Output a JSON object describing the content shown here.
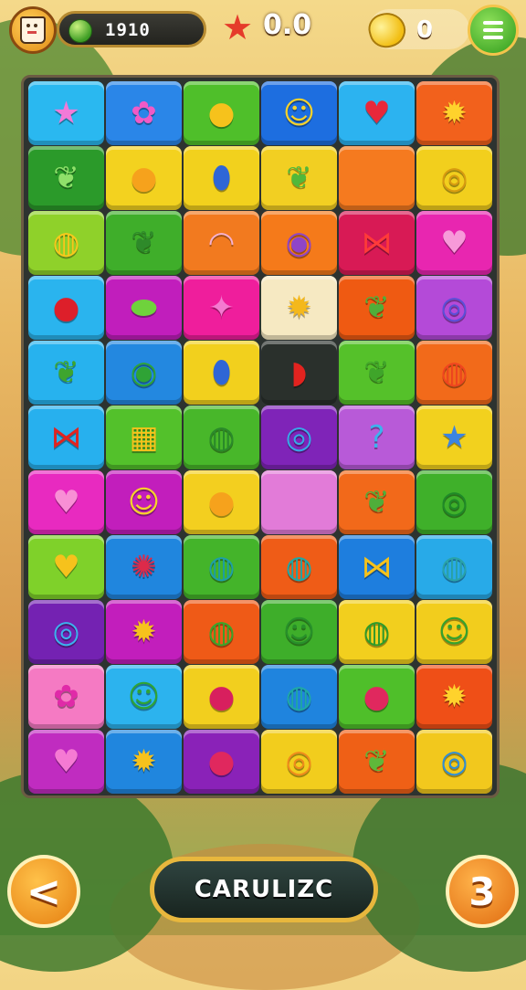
{
  "hud": {
    "coins": "1910",
    "score": "0.0",
    "lemons": "0"
  },
  "board": {
    "rows": [
      [
        {
          "color": "#2ab8f0",
          "icon": "star-icon",
          "glyph": "★",
          "fg": "#f27ad8"
        },
        {
          "color": "#2a86e8",
          "icon": "flower-icon",
          "glyph": "✿",
          "fg": "#f05ac6"
        },
        {
          "color": "#4fbf2a",
          "icon": "apple-icon",
          "glyph": "●",
          "fg": "#f6c21c"
        },
        {
          "color": "#1d6ee0",
          "icon": "sun-face-icon",
          "glyph": "☺",
          "fg": "#f6d22b"
        },
        {
          "color": "#2cb3f0",
          "icon": "heart-icon",
          "glyph": "♥",
          "fg": "#e8283a"
        },
        {
          "color": "#f2611c",
          "icon": "sun-icon",
          "glyph": "✹",
          "fg": "#ffd22c"
        }
      ],
      [
        {
          "color": "#2b9a2a",
          "icon": "leaf-icon",
          "glyph": "❦",
          "fg": "#8fe06a"
        },
        {
          "color": "#f3d21f",
          "icon": "apple-icon",
          "glyph": "●",
          "fg": "#f6a21c"
        },
        {
          "color": "#f2d11d",
          "icon": "egg-icon",
          "glyph": "⬮",
          "fg": "#2f66d6"
        },
        {
          "color": "#f2cf22",
          "icon": "leaf-icon",
          "glyph": "❦",
          "fg": "#52b83a"
        },
        {
          "color": "#f57a1f",
          "icon": "empty-icon",
          "glyph": "",
          "fg": "#ffffff"
        },
        {
          "color": "#f2cf1d",
          "icon": "spiral-icon",
          "glyph": "◎",
          "fg": "#d89b10"
        }
      ],
      [
        {
          "color": "#8fd12a",
          "icon": "swirl-icon",
          "glyph": "◍",
          "fg": "#f6c81c"
        },
        {
          "color": "#3fae2a",
          "icon": "leaf-icon",
          "glyph": "❦",
          "fg": "#2e8a2a"
        },
        {
          "color": "#f27a1f",
          "icon": "lips-icon",
          "glyph": "◠",
          "fg": "#f5b1d0"
        },
        {
          "color": "#f57a1a",
          "icon": "eye-icon",
          "glyph": "◉",
          "fg": "#8f45c8"
        },
        {
          "color": "#d81a55",
          "icon": "bow-icon",
          "glyph": "⋈",
          "fg": "#ff3a3a"
        },
        {
          "color": "#e826b0",
          "icon": "heart-icon",
          "glyph": "♥",
          "fg": "#f79ad9"
        }
      ],
      [
        {
          "color": "#2ab4ee",
          "icon": "cherry-icon",
          "glyph": "●",
          "fg": "#dd1f2a"
        },
        {
          "color": "#c11ebc",
          "icon": "blob-icon",
          "glyph": "⬬",
          "fg": "#6fd23c"
        },
        {
          "color": "#ef1e9c",
          "icon": "star-icon",
          "glyph": "✦",
          "fg": "#f47ad0"
        },
        {
          "color": "#f6e9c2",
          "icon": "sun-icon",
          "glyph": "✹",
          "fg": "#f4b81c"
        },
        {
          "color": "#ef5a12",
          "icon": "leaf-icon",
          "glyph": "❦",
          "fg": "#4fae3a"
        },
        {
          "color": "#b44ad8",
          "icon": "spiral-icon",
          "glyph": "◎",
          "fg": "#5b4fd8"
        }
      ],
      [
        {
          "color": "#27b2ee",
          "icon": "leaf-icon",
          "glyph": "❦",
          "fg": "#3ea52e"
        },
        {
          "color": "#2388e0",
          "icon": "circle-icon",
          "glyph": "◉",
          "fg": "#2fa336"
        },
        {
          "color": "#f2d01d",
          "icon": "egg-icon",
          "glyph": "⬮",
          "fg": "#2f66d6"
        },
        {
          "color": "#2a302c",
          "icon": "leaf-icon",
          "glyph": "◗",
          "fg": "#e2231f"
        },
        {
          "color": "#55c12a",
          "icon": "leaf-icon",
          "glyph": "❦",
          "fg": "#3fa52a"
        },
        {
          "color": "#f26a1a",
          "icon": "blob-icon",
          "glyph": "◍",
          "fg": "#f0451f"
        }
      ],
      [
        {
          "color": "#27b0ee",
          "icon": "bow-icon",
          "glyph": "⋈",
          "fg": "#e2231f"
        },
        {
          "color": "#53c12b",
          "icon": "card-icon",
          "glyph": "▦",
          "fg": "#f6c21c"
        },
        {
          "color": "#48b72a",
          "icon": "swirl-icon",
          "glyph": "◍",
          "fg": "#2a8a2a"
        },
        {
          "color": "#7f24b8",
          "icon": "spiral-icon",
          "glyph": "◎",
          "fg": "#38a8e8"
        },
        {
          "color": "#b85ad8",
          "icon": "question-icon",
          "glyph": "?",
          "fg": "#3cb2ee"
        },
        {
          "color": "#f2d11e",
          "icon": "star-icon",
          "glyph": "★",
          "fg": "#3b84e2"
        }
      ],
      [
        {
          "color": "#e82ac0",
          "icon": "heart-icon",
          "glyph": "♥",
          "fg": "#f88fd5"
        },
        {
          "color": "#c21ebc",
          "icon": "sun-face-icon",
          "glyph": "☺",
          "fg": "#f6d22b"
        },
        {
          "color": "#f3cf1f",
          "icon": "lemon-icon",
          "glyph": "●",
          "fg": "#f6a21c"
        },
        {
          "color": "#e27bd8",
          "icon": "empty-icon",
          "glyph": "",
          "fg": "#ffffff"
        },
        {
          "color": "#f2691a",
          "icon": "leaf-icon",
          "glyph": "❦",
          "fg": "#4fae3a"
        },
        {
          "color": "#3fb02a",
          "icon": "circle-icon",
          "glyph": "◎",
          "fg": "#1f8a28"
        }
      ],
      [
        {
          "color": "#7fd12a",
          "icon": "heart-icon",
          "glyph": "♥",
          "fg": "#f6c21c"
        },
        {
          "color": "#2086de",
          "icon": "berry-icon",
          "glyph": "✺",
          "fg": "#dd2a4a"
        },
        {
          "color": "#44b42a",
          "icon": "swirl-icon",
          "glyph": "◍",
          "fg": "#1e9fa6"
        },
        {
          "color": "#ef5c17",
          "icon": "swirl-icon",
          "glyph": "◍",
          "fg": "#1fa8a6"
        },
        {
          "color": "#1e7ede",
          "icon": "bow-icon",
          "glyph": "⋈",
          "fg": "#f6c21c"
        },
        {
          "color": "#28aae8",
          "icon": "swirl-icon",
          "glyph": "◍",
          "fg": "#2aa3a8"
        }
      ],
      [
        {
          "color": "#7422b2",
          "icon": "spiral-icon",
          "glyph": "◎",
          "fg": "#3cb2ee"
        },
        {
          "color": "#c21ebc",
          "icon": "sun-icon",
          "glyph": "✹",
          "fg": "#f6c21c"
        },
        {
          "color": "#ef5a17",
          "icon": "swirl-icon",
          "glyph": "◍",
          "fg": "#3aa52a"
        },
        {
          "color": "#3eae2a",
          "icon": "circle-icon",
          "glyph": "☺",
          "fg": "#27902a"
        },
        {
          "color": "#f2cf1e",
          "icon": "swirl-icon",
          "glyph": "◍",
          "fg": "#2f9a2a"
        },
        {
          "color": "#f2cd1d",
          "icon": "circle-icon",
          "glyph": "☺",
          "fg": "#35a22e"
        }
      ],
      [
        {
          "color": "#f57ac3",
          "icon": "flower-icon",
          "glyph": "✿",
          "fg": "#e02aa8"
        },
        {
          "color": "#2cb3ee",
          "icon": "circle-icon",
          "glyph": "☺",
          "fg": "#2fa336"
        },
        {
          "color": "#f2cf1e",
          "icon": "egg-icon",
          "glyph": "●",
          "fg": "#d81f5e"
        },
        {
          "color": "#1f84de",
          "icon": "swirl-icon",
          "glyph": "◍",
          "fg": "#1fa8a6"
        },
        {
          "color": "#4fbf2a",
          "icon": "cherry-icon",
          "glyph": "●",
          "fg": "#e0285e"
        },
        {
          "color": "#ef4f17",
          "icon": "sun-icon",
          "glyph": "✹",
          "fg": "#ffd22c"
        }
      ],
      [
        {
          "color": "#c02cc0",
          "icon": "heart-icon",
          "glyph": "♥",
          "fg": "#f57ad3"
        },
        {
          "color": "#2086de",
          "icon": "sun-icon",
          "glyph": "✹",
          "fg": "#f6c21c"
        },
        {
          "color": "#8a22b8",
          "icon": "egg-icon",
          "glyph": "●",
          "fg": "#e0285e"
        },
        {
          "color": "#f2cd1d",
          "icon": "spiral-icon",
          "glyph": "◎",
          "fg": "#f08a1c"
        },
        {
          "color": "#ef6016",
          "icon": "leaf-icon",
          "glyph": "❦",
          "fg": "#5fb83a"
        },
        {
          "color": "#f2c81d",
          "icon": "spiral-icon",
          "glyph": "◎",
          "fg": "#2f8ed8"
        }
      ]
    ]
  },
  "buttons": {
    "back_glyph": "<",
    "action_label": "CARULIZC",
    "level": "3"
  }
}
